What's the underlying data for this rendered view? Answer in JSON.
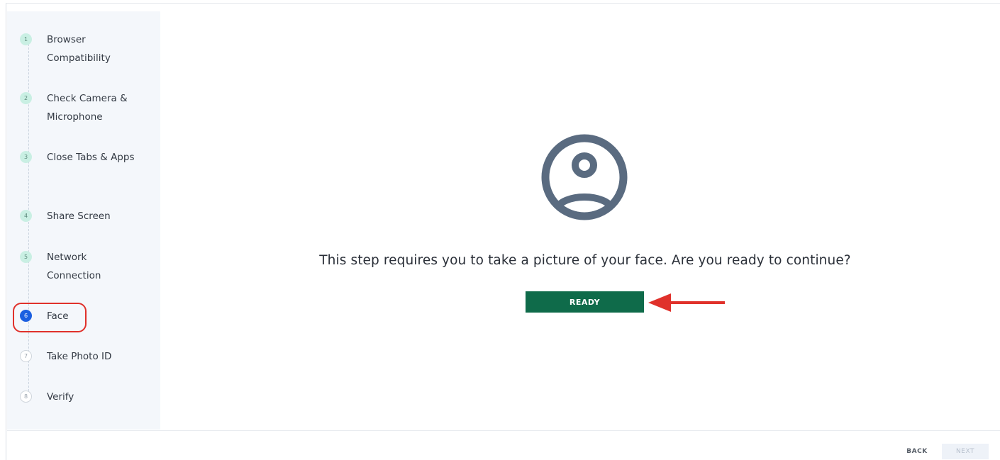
{
  "steps": [
    {
      "number": "1",
      "label": "Browser Compatibility",
      "state": "done"
    },
    {
      "number": "2",
      "label": "Check Camera & Microphone",
      "state": "done"
    },
    {
      "number": "3",
      "label": "Close Tabs & Apps",
      "state": "done"
    },
    {
      "number": "4",
      "label": "Share Screen",
      "state": "done"
    },
    {
      "number": "5",
      "label": "Network Connection",
      "state": "done"
    },
    {
      "number": "6",
      "label": "Face",
      "state": "active"
    },
    {
      "number": "7",
      "label": "Take Photo ID",
      "state": "todo"
    },
    {
      "number": "8",
      "label": "Verify",
      "state": "todo"
    }
  ],
  "main": {
    "icon": "user-circle-icon",
    "prompt": "This step requires you to take a picture of your face. Are you ready to continue?",
    "ready_label": "READY"
  },
  "annotation": {
    "highlight_color": "#e0312b",
    "arrow_icon": "arrow-left-icon"
  },
  "footer": {
    "back_label": "BACK",
    "next_label": "NEXT"
  },
  "colors": {
    "ready_button": "#0f6b4a",
    "active_step": "#1b5fe0",
    "done_step": "#c9efe3",
    "icon": "#5a6b80"
  }
}
